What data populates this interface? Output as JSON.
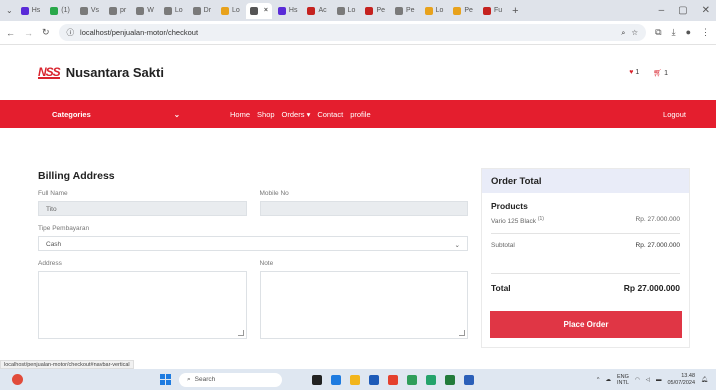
{
  "browser": {
    "tabs": [
      {
        "label": "Hs",
        "color": "#5a2bd8"
      },
      {
        "label": "(1)",
        "color": "#2aa84a"
      },
      {
        "label": "Vs",
        "color": "#7a7a7a"
      },
      {
        "label": "pr",
        "color": "#7a7a7a"
      },
      {
        "label": "W",
        "color": "#7a7a7a"
      },
      {
        "label": "Lo",
        "color": "#7a7a7a"
      },
      {
        "label": "Dr",
        "color": "#7a7a7a"
      },
      {
        "label": "Lo",
        "color": "#e8a21c"
      },
      {
        "label": "",
        "color": "#555",
        "active": true
      },
      {
        "label": "Hs",
        "color": "#5a2bd8"
      },
      {
        "label": "Ac",
        "color": "#c5221f"
      },
      {
        "label": "Lo",
        "color": "#7a7a7a"
      },
      {
        "label": "Pe",
        "color": "#c5221f"
      },
      {
        "label": "Pe",
        "color": "#7a7a7a"
      },
      {
        "label": "Lo",
        "color": "#e8a21c"
      },
      {
        "label": "Pe",
        "color": "#e8a21c"
      },
      {
        "label": "Fu",
        "color": "#c5221f"
      }
    ],
    "new_tab": "+",
    "url": "localhost/penjualan-motor/checkout",
    "window_controls": [
      "–",
      "▢",
      "✕"
    ]
  },
  "site": {
    "logo_mark": "NSS",
    "brand": "Nusantara Sakti",
    "wishlist_count": "1",
    "cart_count": "1"
  },
  "nav": {
    "categories": "Categories",
    "links": [
      "Home",
      "Shop",
      "Orders",
      "Contact",
      "profile"
    ],
    "logout": "Logout"
  },
  "billing": {
    "title": "Billing Address",
    "full_name_label": "Full Name",
    "full_name_value": "Tito",
    "mobile_label": "Mobile No",
    "mobile_value": "",
    "payment_label": "Tipe Pembayaran",
    "payment_value": "Cash",
    "address_label": "Address",
    "note_label": "Note"
  },
  "order": {
    "title": "Order Total",
    "products_label": "Products",
    "product_name": "Vario 125 Black",
    "product_qty": "(1)",
    "product_price": "Rp. 27.000.000",
    "subtotal_label": "Subtotal",
    "subtotal_value": "Rp. 27.000.000",
    "total_label": "Total",
    "total_value": "Rp 27.000.000",
    "place_order": "Place Order"
  },
  "status_url": "localhost/penjualan-motor/checkout#navbar-vertical",
  "taskbar": {
    "search_placeholder": "Search",
    "app_colors": [
      "#222",
      "#1e7be0",
      "#f2b51c",
      "#1e5bb8",
      "#e5412e",
      "#2f9e5a",
      "#24a36b",
      "#227b3a",
      "#2b5fb8"
    ],
    "lang": "ENG",
    "region": "INTL",
    "time": "13.48",
    "date": "05/07/2024"
  },
  "colors": {
    "accent": "#e41e2e",
    "button": "#e03645"
  }
}
